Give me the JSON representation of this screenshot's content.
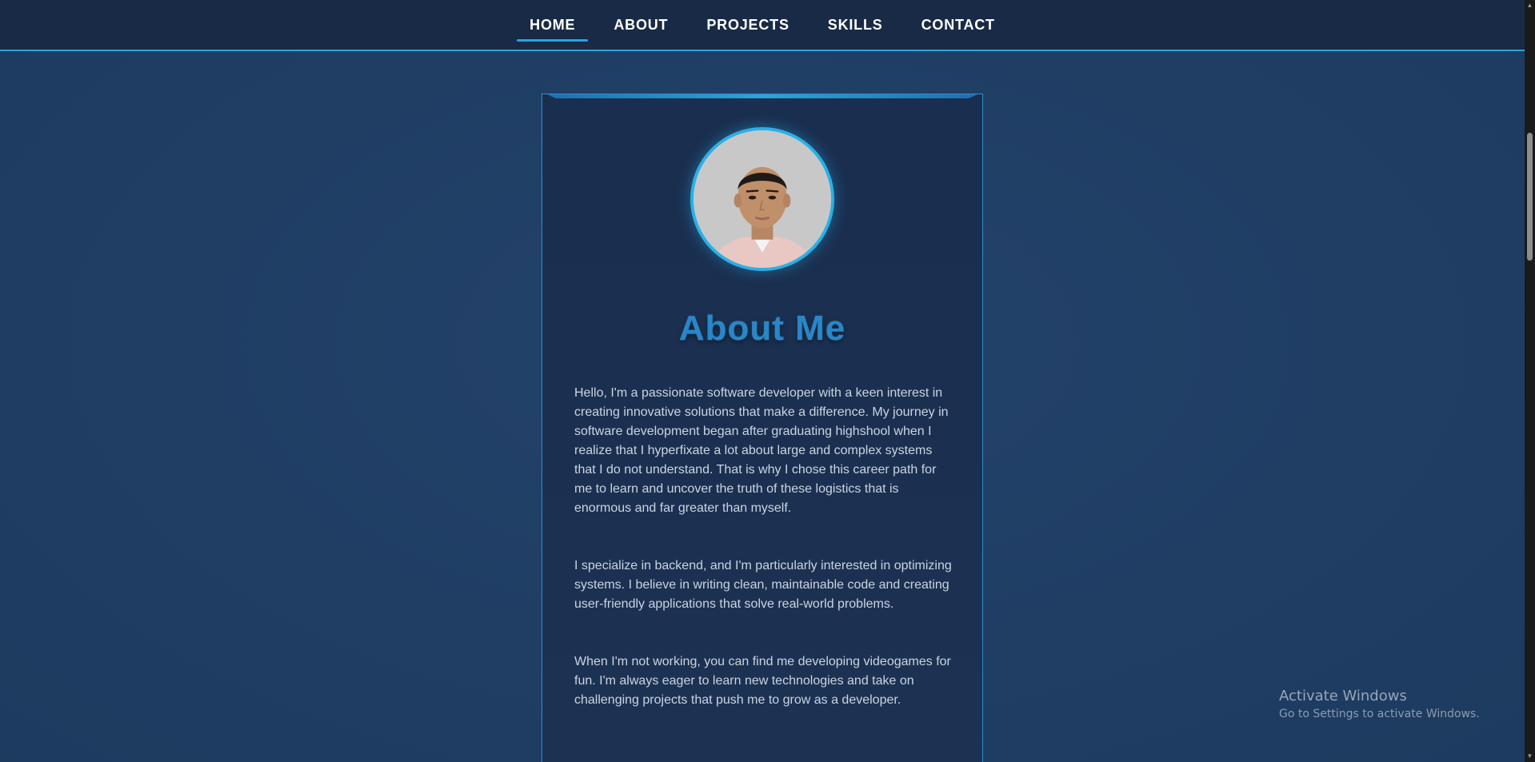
{
  "nav": {
    "items": [
      {
        "label": "HOME",
        "active": true
      },
      {
        "label": "ABOUT",
        "active": false
      },
      {
        "label": "PROJECTS",
        "active": false
      },
      {
        "label": "SKILLS",
        "active": false
      },
      {
        "label": "CONTACT",
        "active": false
      }
    ]
  },
  "about": {
    "title": "About Me",
    "paragraphs": [
      "Hello, I'm a passionate software developer with a keen interest in creating innovative solutions that make a difference. My journey in software development began after graduating highshool when I realize that I hyperfixate a lot about large and complex systems that I do not understand. That is why I chose this career path for me to learn and uncover the truth of these logistics that is enormous and far greater than myself.",
      "I specialize in backend, and I'm particularly interested in optimizing systems. I believe in writing clean, maintainable code and creating user-friendly applications that solve real-world problems.",
      "When I'm not working, you can find me developing videogames for fun. I'm always eager to learn new technologies and take on challenging projects that push me to grow as a developer."
    ]
  },
  "watermark": {
    "title": "Activate Windows",
    "subtitle": "Go to Settings to activate Windows."
  },
  "colors": {
    "accent": "#2aa4db",
    "nav_bg": "#182a45",
    "page_bg": "#213f66",
    "title": "#2a86c8"
  },
  "icons": {
    "profile": "profile-photo"
  }
}
